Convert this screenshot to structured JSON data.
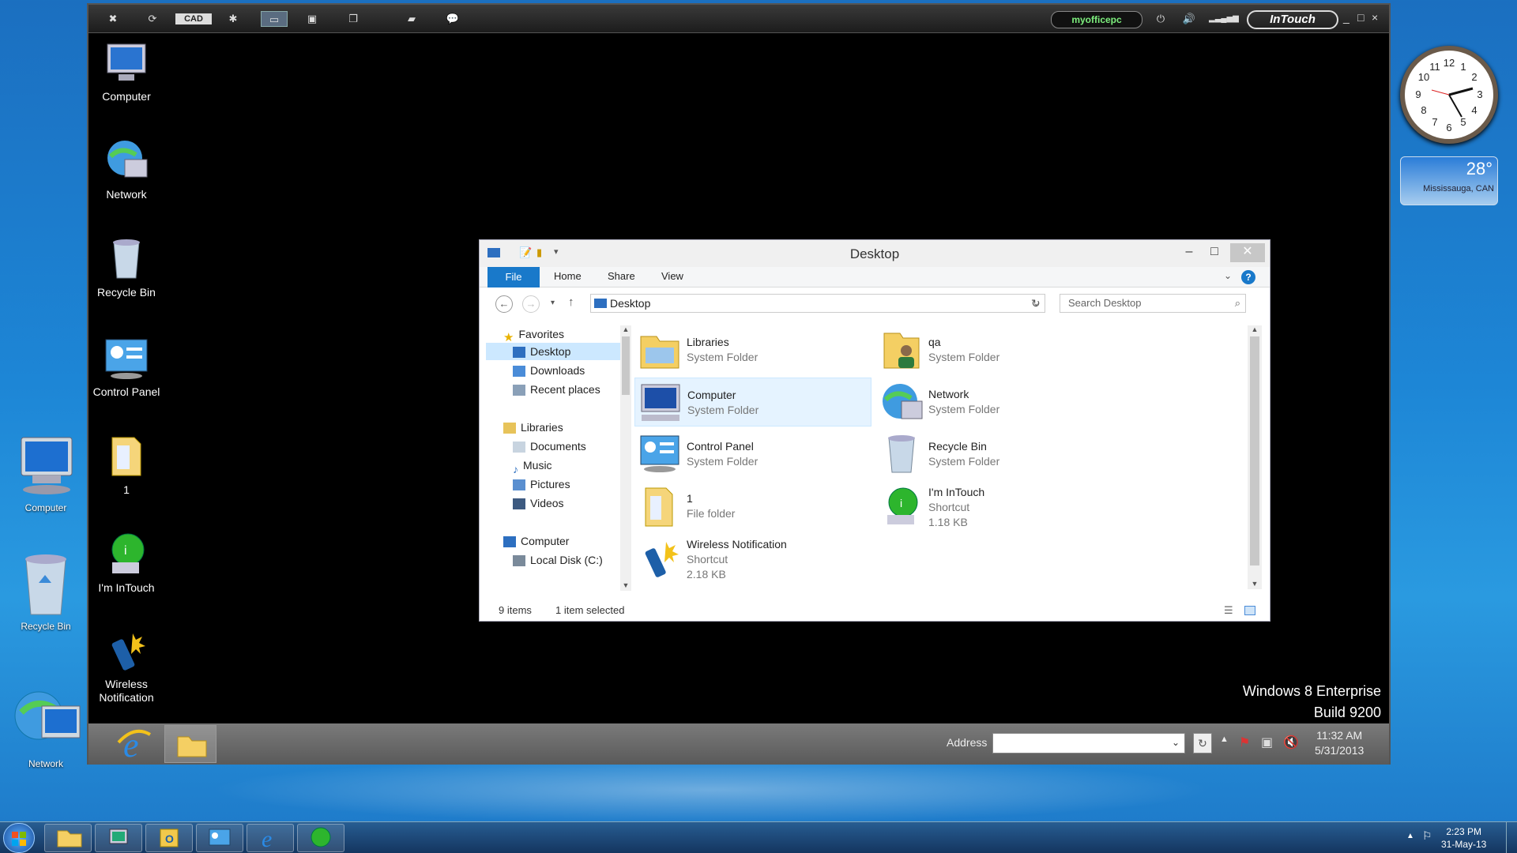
{
  "outer_desktop": {
    "icons": [
      {
        "label": "Computer"
      },
      {
        "label": "Recycle Bin"
      },
      {
        "label": "Network"
      }
    ]
  },
  "remote_toolbar": {
    "buttons": [
      "close-icon",
      "refresh-icon",
      "cad-button",
      "settings-icon",
      "screen-icon",
      "monitor-icon",
      "multi-window-icon",
      "folder-icon",
      "chat-icon"
    ],
    "cad_label": "CAD",
    "computer_name": "myofficepc",
    "logo_text": "InTouch",
    "window_controls": [
      "_",
      "□",
      "×"
    ]
  },
  "inner_desktop": {
    "icons": [
      {
        "label": "Computer"
      },
      {
        "label": "Network"
      },
      {
        "label": "Recycle Bin"
      },
      {
        "label": "Control Panel"
      },
      {
        "label": "1"
      },
      {
        "label": "I'm InTouch"
      },
      {
        "label": "Wireless Notification"
      }
    ]
  },
  "explorer": {
    "title": "Desktop",
    "tabs": {
      "file": "File",
      "home": "Home",
      "share": "Share",
      "view": "View"
    },
    "address": "Desktop",
    "search_placeholder": "Search Desktop",
    "nav": {
      "favorites": "Favorites",
      "desktop": "Desktop",
      "downloads": "Downloads",
      "recent": "Recent places",
      "libraries": "Libraries",
      "documents": "Documents",
      "music": "Music",
      "pictures": "Pictures",
      "videos": "Videos",
      "computer": "Computer",
      "localdisk": "Local Disk (C:)"
    },
    "items": [
      {
        "name": "Libraries",
        "sub": "System Folder",
        "size": ""
      },
      {
        "name": "qa",
        "sub": "System Folder",
        "size": ""
      },
      {
        "name": "Computer",
        "sub": "System Folder",
        "size": ""
      },
      {
        "name": "Network",
        "sub": "System Folder",
        "size": ""
      },
      {
        "name": "Control Panel",
        "sub": "System Folder",
        "size": ""
      },
      {
        "name": "Recycle Bin",
        "sub": "System Folder",
        "size": ""
      },
      {
        "name": "1",
        "sub": "File folder",
        "size": ""
      },
      {
        "name": "I'm InTouch",
        "sub": "Shortcut",
        "size": "1.18 KB"
      },
      {
        "name": "Wireless Notification",
        "sub": "Shortcut",
        "size": "2.18 KB"
      }
    ],
    "status": {
      "count": "9 items",
      "selected": "1 item selected"
    }
  },
  "remote_taskbar": {
    "address_label": "Address",
    "time": "11:32 AM",
    "date": "5/31/2013"
  },
  "watermark": {
    "line1": "Windows 8 Enterprise",
    "line2": "Build 9200"
  },
  "weather": {
    "temp": "28°",
    "location": "Mississauga, CAN"
  },
  "outer_taskbar": {
    "time": "2:23 PM",
    "date": "31-May-13"
  },
  "colors": {
    "accent": "#1979ca",
    "desktop_blue": "#1d86d6",
    "selected": "#cce8ff"
  }
}
